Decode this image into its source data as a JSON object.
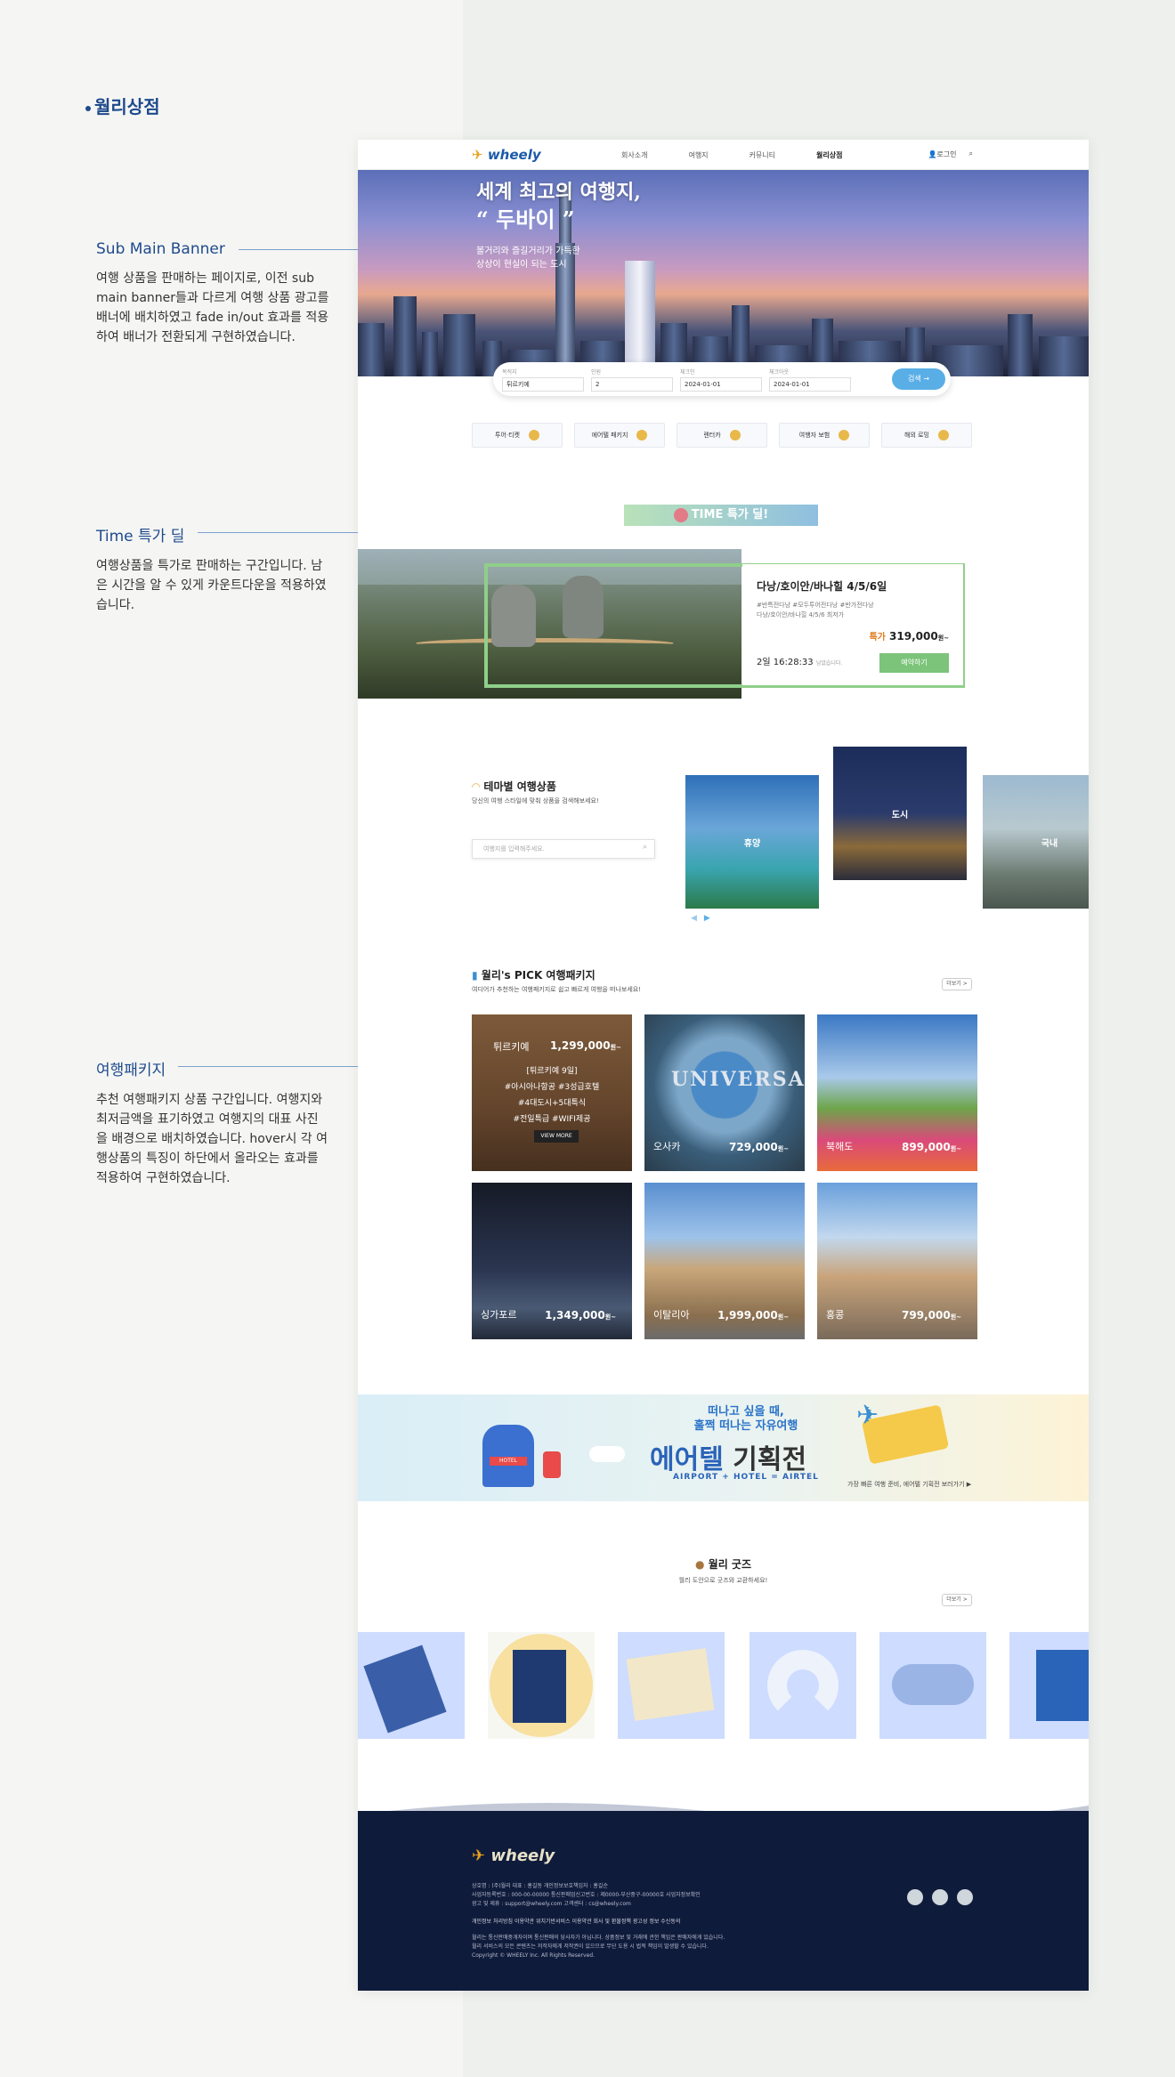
{
  "brand_title": "월리상점",
  "annotations": [
    {
      "title": "Sub Main Banner",
      "body": "여행 상품을 판매하는 페이지로, 이전 sub main banner들과 다르게 여행 상품 광고를 배너에 배치하였고 fade in/out 효과를 적용하여 배너가 전환되게 구현하였습니다."
    },
    {
      "title": "Time 특가 딜",
      "body": "여행상품을 특가로 판매하는 구간입니다. 남은 시간을 알 수 있게 카운트다운을 적용하였습니다."
    },
    {
      "title": "여행패키지",
      "body": "추천 여행패키지 상품 구간입니다. 여행지와 최저금액을 표기하였고 여행지의 대표 사진을 배경으로 배치하였습니다. hover시 각 여행상품의 특징이 하단에서 올라오는 효과를 적용하여 구현하였습니다."
    }
  ],
  "nav": {
    "logo": "wheely",
    "menu": [
      "회사소개",
      "여행지",
      "커뮤니티",
      "월리상점"
    ],
    "login": "로그인"
  },
  "hero": {
    "line1": "세계 최고의 여행지,",
    "line2": "“ 두바이 ”",
    "line3": "볼거리와 즐길거리가 가득한",
    "line4": "상상이 현실이 되는 도시"
  },
  "search": {
    "fields": [
      {
        "label": "목적지",
        "value": "튀르키예"
      },
      {
        "label": "인원",
        "value": "2"
      },
      {
        "label": "체크인",
        "value": "2024-01-01"
      },
      {
        "label": "체크아웃",
        "value": "2024-01-01"
      }
    ],
    "button": "검색"
  },
  "categories": [
    "투어·티켓",
    "에어텔 패키지",
    "렌터카",
    "여행자 보험",
    "해외 로밍"
  ],
  "timedeal": {
    "badge": "TIME 특가 딜!",
    "title": "다낭/호이안/바나힐 4/5/6일",
    "tags1": "#반특전다낭 #모두투어전다낭 #반가전다낭",
    "tags2": "다낭/호이안/바나힐 4/5/6 최저가",
    "price_label": "특가",
    "price": "319,000",
    "price_unit": "원~",
    "countdown": "2일 16:28:33",
    "countdown_suffix": "남았습니다.",
    "button": "예약하기"
  },
  "theme": {
    "title": "테마별 여행상품",
    "subtitle": "당신의 여행 스타일에 맞춰 상품을 검색해보세요!",
    "placeholder": "여행지를 입력해주세요.",
    "cards": [
      "휴양",
      "도시",
      "국내"
    ]
  },
  "pick": {
    "title": "월리's PICK 여행패키지",
    "subtitle": "여디어가 추천하는 여행패키지로 쉽고 빠르게 여행을 떠나보세요!",
    "more": "더보기 >",
    "items": [
      {
        "name": "튀르키예",
        "price": "1,299,000",
        "unit": "원~"
      },
      {
        "name": "오사카",
        "price": "729,000",
        "unit": "원~"
      },
      {
        "name": "북해도",
        "price": "899,000",
        "unit": "원~"
      },
      {
        "name": "싱가포르",
        "price": "1,349,000",
        "unit": "원~"
      },
      {
        "name": "이탈리아",
        "price": "1,999,000",
        "unit": "원~"
      },
      {
        "name": "홍콩",
        "price": "799,000",
        "unit": "원~"
      }
    ],
    "hover_tags": [
      "[튀르키예 9일]",
      "#아시아나항공 #3성급호텔",
      "#4대도시+5대특식",
      "#전일특급 #WIFI제공"
    ],
    "view_more": "VIEW MORE"
  },
  "banner": {
    "line1": "떠나고 싶을 때,",
    "line2": "훌쩍 떠나는 자유여행",
    "big1": "에어텔",
    "big2": "기획전",
    "sub": "AIRPORT + HOTEL = AIRTEL",
    "link": "가장 빠른 여행 준비, 에어텔 기획전 보러가기 ▶",
    "hotel_sign": "HOTEL"
  },
  "goods": {
    "title": "월리 굿즈",
    "subtitle": "월리 도안으로 굿즈와 교환하세요!",
    "more": "더보기 >"
  },
  "footer": {
    "logo": "wheely",
    "info1": "상호명 : (주)월리      대표 : 홍길동      개인정보보호책임자 : 홍길순",
    "info2": "사업자등록번호 : 000-00-00000      통신판매업신고번호 : 제0000-부산중구-00000호      사업자정보확인",
    "info3": "광고 및 제휴 : support@wheely.com      고객센터 : cs@wheely.com",
    "links": "개인정보 처리방침      이용약관      위치기반서비스 이용약관      회사 및 환불정책      광고성 정보 수신동의",
    "notice1": "월리는 통신판매중개자이며 통신판매의 당사자가 아닙니다. 상품정보 및 거래에 관한 책임은 판매자에게 있습니다.",
    "notice2": "월리 서비스의 모든 콘텐츠는 저작자에게 저작권이 있으므로 무단 도용 시 법적 책임이 발생할 수 있습니다.",
    "copyright": "Copyright © WHEELY Inc. All Rights Reserved."
  }
}
